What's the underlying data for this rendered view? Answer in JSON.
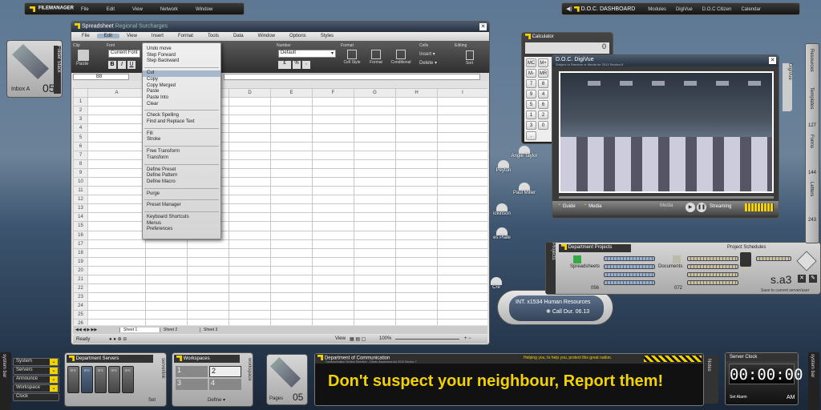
{
  "topbar": {
    "app_title": "FILEMANAGER",
    "menus": [
      "File",
      "Edit",
      "View",
      "Network",
      "Window"
    ],
    "dashboard_title": "D.O.C. DASHBOARD",
    "links": [
      "Modules",
      "DigiVue",
      "D.O.C Citizen",
      "Calendar"
    ]
  },
  "inbox": {
    "label": "Inbox A",
    "count": "05",
    "side_tab": "Folder Stack"
  },
  "spreadsheet": {
    "title": "Spreadsheet",
    "doc": "Regional Surcharges",
    "menu": [
      "File",
      "Edit",
      "View",
      "Insert",
      "Format",
      "Tools",
      "Data",
      "Window",
      "Options",
      "Styles"
    ],
    "ribbon_groups": [
      "Clip",
      "Font",
      "Number",
      "Format",
      "Cells",
      "Editing"
    ],
    "paste": "Paste",
    "font_name": "Current Font",
    "number_format": "Default",
    "format_buttons": [
      "Cell Style",
      "Format",
      "Conditional"
    ],
    "cells_buttons": [
      "Insert",
      "Delete"
    ],
    "sort_label": "Sort",
    "cell_ref": "B8",
    "columns": [
      "A",
      "B",
      "C",
      "D",
      "E",
      "F",
      "G",
      "H",
      "I"
    ],
    "rows": [
      "1",
      "2",
      "3",
      "4",
      "5",
      "6",
      "7",
      "8",
      "9",
      "10",
      "11",
      "12",
      "13",
      "14",
      "15",
      "16",
      "17",
      "18",
      "19",
      "20",
      "21",
      "22",
      "23",
      "24",
      "25",
      "26"
    ],
    "sheets": [
      "Sheet 1",
      "Sheet 2",
      "Sheet 3"
    ],
    "status": "Ready",
    "view_label": "View",
    "zoom": "100%"
  },
  "edit_menu": {
    "groups": [
      [
        "Undo move",
        "Step Forward",
        "Step Backward"
      ],
      [
        "Cut",
        "Copy",
        "Copy Merged",
        "Paste",
        "Paste Into",
        "Clear"
      ],
      [
        "Check Spelling",
        "Find and Replace Text"
      ],
      [
        "Fill",
        "Stroke"
      ],
      [
        "Free Transform",
        "Transform"
      ],
      [
        "Define Preset",
        "Define Pattern",
        "Define Macro"
      ],
      [
        "Purge"
      ],
      [
        "Preset Manager"
      ],
      [
        "Keyboard Shortcuts",
        "Menus",
        "Preferences"
      ]
    ],
    "highlighted": "Cut"
  },
  "calculator": {
    "title": "Calculator",
    "display": "0",
    "keys": [
      "MC",
      "M+",
      "M-",
      "MR",
      "7",
      "8",
      "9",
      "4",
      "5",
      "6",
      "1",
      "2",
      "3",
      "0",
      "."
    ]
  },
  "digivue": {
    "title": "D.O.C. DigiVue",
    "subtitle": "Subject to Random or Media for 2013 Section 8",
    "tabs": [
      "Guide",
      "Media"
    ],
    "media_label": "Media",
    "streaming": "Streaming",
    "side_tab": "DigiVue"
  },
  "contacts": [
    "Angie Taylor",
    "Peyton",
    "Paul Miller",
    "ickinson",
    "es Plate",
    "Cre"
  ],
  "call": {
    "text": "INT. x1534 Human Resources",
    "duration": "Call Dur. 06.13"
  },
  "dept_projects": {
    "title": "Department Projects",
    "schedules": "Project Schedules",
    "side_tab": "Projects",
    "items": [
      {
        "label": "Spreadsheets",
        "count": "056"
      },
      {
        "label": "Documents",
        "count": "072"
      }
    ],
    "code": "s.a3",
    "footer": "Save to current server/user"
  },
  "right_sidebar": {
    "items": [
      "Resources",
      "Templates",
      "127",
      "Forms",
      "144",
      "Letters",
      "243"
    ]
  },
  "bottom": {
    "system_bar": "system bar",
    "side_buttons": [
      "System",
      "Servers",
      "Announce",
      "Workspace",
      "Clock"
    ],
    "dept_servers": {
      "title": "Department Servers",
      "servers": [
        "srv.",
        "srv.",
        "srv.",
        "srv.",
        "srv."
      ],
      "set": "Set",
      "side_tab": "serverlink"
    },
    "workspaces": {
      "title": "Workspaces",
      "numbers": [
        "1",
        "2",
        "3",
        "4"
      ],
      "define": "Define",
      "side_tab": "workspace"
    },
    "pages": {
      "label": "Pages",
      "count": "05"
    },
    "announcement": {
      "dept": "Department of Communication",
      "subtitle": "Communication Service Directive - Citizen Awareness Act 2019 Section 7",
      "tagline": "Helping you, to help you, protect this great nation.",
      "message": "Don't suspect your neighbour, Report them!",
      "side_tab": "Notes"
    },
    "clock": {
      "title": "Server Clock",
      "time": "00:00:00",
      "ampm": "AM",
      "set_alarm": "Set Alarm"
    },
    "right_tab": "system bar"
  }
}
